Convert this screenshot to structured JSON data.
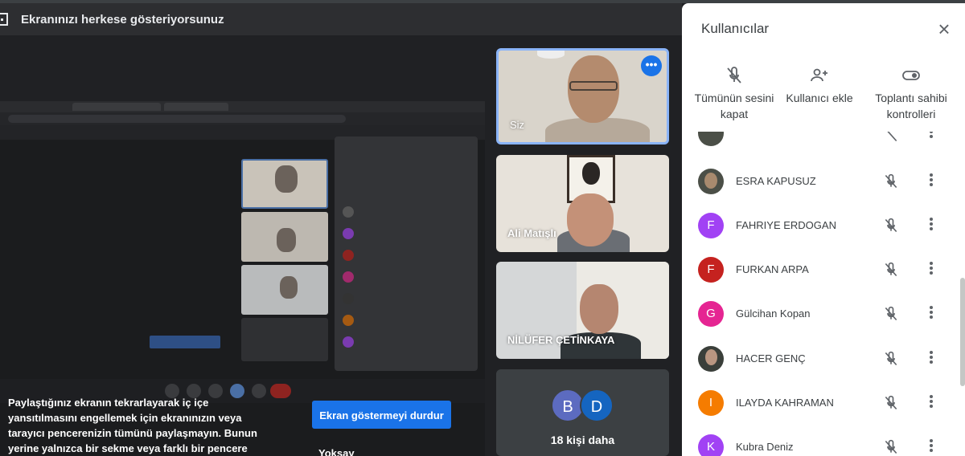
{
  "banner": {
    "title": "Ekranınızı herkese gösteriyorsunuz",
    "icon": "present-screen-icon"
  },
  "notice": {
    "text": "Paylaştığınız ekranın tekrarlayarak iç içe yansıtılmasını engellemek için ekranınızın veya tarayıcı pencerenizin tümünü paylaşmayın. Bunun yerine yalnızca bir sekme veya farklı bir pencere",
    "stop_label": "Ekran göstermeyi durdur",
    "ignore_label": "Yoksay"
  },
  "tiles": {
    "self": {
      "name": "Siz",
      "menu_icon": "more-horizontal-icon"
    },
    "ali": {
      "name": "Ali Matışlı"
    },
    "nilufer": {
      "name": "NİLÜFER ÇETİNKAYA"
    },
    "more": {
      "avatars": [
        "B",
        "D"
      ],
      "label": "18 kişi daha",
      "colors": [
        "#5c6bc0",
        "#1565c0"
      ]
    }
  },
  "panel": {
    "title": "Kullanıcılar",
    "close_icon": "close-icon",
    "actions": [
      {
        "label": "Tümünün sesini kapat",
        "icon": "mic-off-icon"
      },
      {
        "label": "Kullanıcı ekle",
        "icon": "person-add-icon"
      },
      {
        "label": "Toplantı sahibi kontrolleri",
        "icon": "toggle-icon"
      }
    ],
    "participants": [
      {
        "name": "ESRA KAPUSUZ",
        "initial": "",
        "color": "#4b4f47",
        "photo": true
      },
      {
        "name": "FAHRIYE ERDOGAN",
        "initial": "F",
        "color": "#a142f4",
        "photo": false
      },
      {
        "name": "FURKAN ARPA",
        "initial": "F",
        "color": "#c5221f",
        "photo": false
      },
      {
        "name": "Gülcihan Kopan",
        "initial": "G",
        "color": "#e52592",
        "photo": false
      },
      {
        "name": "HACER GENÇ",
        "initial": "",
        "color": "#3a3f3a",
        "photo": true
      },
      {
        "name": "ILAYDA KAHRAMAN",
        "initial": "I",
        "color": "#f57c00",
        "photo": false
      },
      {
        "name": "Kubra Deniz",
        "initial": "K",
        "color": "#a142f4",
        "photo": false
      }
    ]
  }
}
